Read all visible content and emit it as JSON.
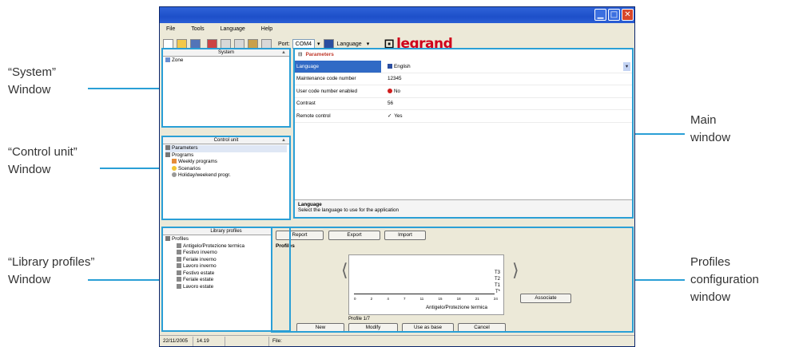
{
  "annotations": {
    "system": [
      "“System”",
      "Window"
    ],
    "control_unit": [
      "“Control unit”",
      "Window"
    ],
    "library_profiles": [
      "“Library profiles”",
      "Window"
    ],
    "main": [
      "Main",
      "window"
    ],
    "profiles_config": [
      "Profiles",
      "configuration",
      "window"
    ]
  },
  "colors": {
    "highlight": "#2a9fd6",
    "selection": "#316ac5",
    "brand": "#d0021b"
  },
  "menu": [
    "File",
    "Tools",
    "Language",
    "Help"
  ],
  "toolbar": {
    "port_label": "Port:",
    "port_value": "COM4",
    "language_button": "Language",
    "logo": "legrand"
  },
  "system_panel": {
    "title": "System",
    "items": [
      "Zone"
    ]
  },
  "control_panel": {
    "title": "Control unit",
    "items": [
      "Parameters",
      "Programs",
      "Weekly programs",
      "Scenarios",
      "Holiday/weekend progr."
    ]
  },
  "library_panel": {
    "title": "Library profiles",
    "root": "Profiles",
    "items": [
      "Antigelo/Protezione termica",
      "Festivo inverno",
      "Feriale inverno",
      "Lavoro inverno",
      "Festivo estate",
      "Feriale estate",
      "Lavoro estate"
    ]
  },
  "parameters": {
    "header": "Parameters",
    "rows": [
      {
        "key": "Language",
        "value": "English",
        "icon": "uk-flag-icon"
      },
      {
        "key": "Maintenance code number",
        "value": "12345"
      },
      {
        "key": "User code number enabled",
        "value": "No",
        "icon": "no-entry-icon"
      },
      {
        "key": "Contrast",
        "value": "56"
      },
      {
        "key": "Remote control",
        "value": "Yes",
        "icon": "checkmark-icon"
      }
    ],
    "desc_title": "Language",
    "desc_text": "Select the language to use for the application"
  },
  "profiles_config": {
    "buttons_top": [
      "Report",
      "Export",
      "Import"
    ],
    "title": "Profiles",
    "levels": [
      "T3",
      "T2",
      "T1",
      "T*"
    ],
    "hours": [
      "0",
      "2",
      "4",
      "7",
      "11",
      "15",
      "18",
      "21",
      "24"
    ],
    "profile_name": "Antigelo/Protezione termica",
    "counter": "Profile 1/7",
    "associate": "Associate",
    "buttons_bottom": [
      "New",
      "Modify",
      "Use as base",
      "Cancel"
    ]
  },
  "status": {
    "date": "22/11/2005",
    "time": "14.19",
    "file_label": "File:"
  }
}
